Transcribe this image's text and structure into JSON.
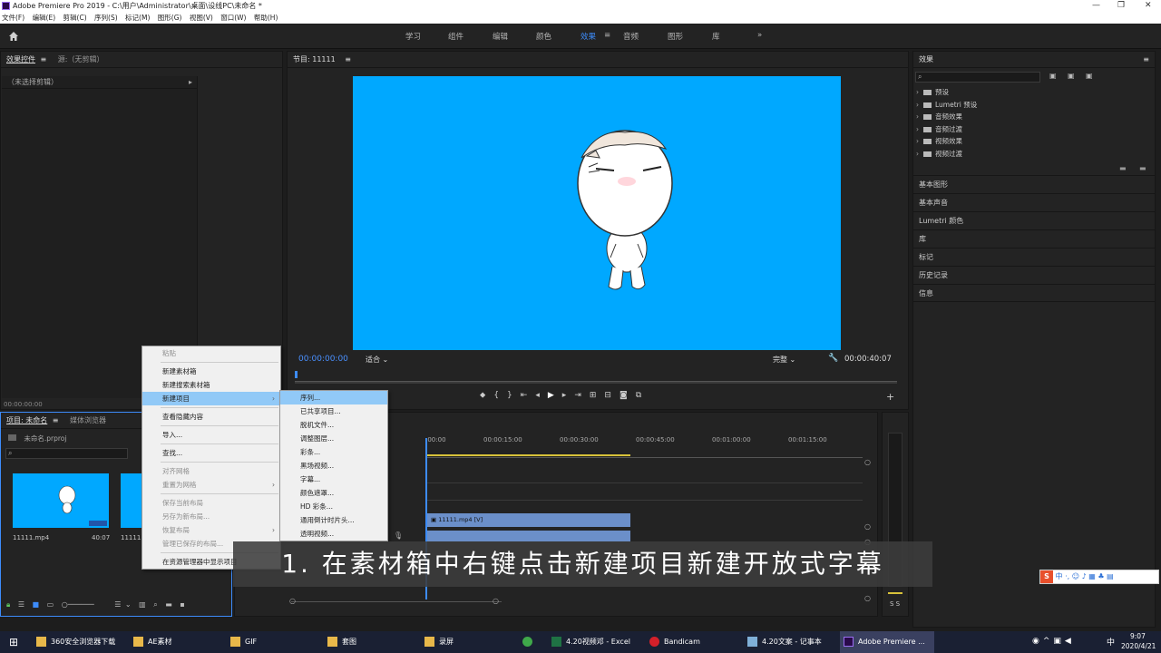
{
  "window": {
    "title": "Adobe Premiere Pro 2019 - C:\\用户\\Administrator\\桌面\\设线PC\\未命名 *"
  },
  "menubar": [
    "文件(F)",
    "编辑(E)",
    "剪辑(C)",
    "序列(S)",
    "标记(M)",
    "图形(G)",
    "视图(V)",
    "窗口(W)",
    "帮助(H)"
  ],
  "workspace": {
    "tabs": [
      "学习",
      "组件",
      "编辑",
      "颜色",
      "效果",
      "音频",
      "图形",
      "库"
    ],
    "active": "效果",
    "more": "»"
  },
  "effect_controls": {
    "tab1": "效果控件",
    "tab2": "源:（无剪辑）",
    "no_clip": "（未选择剪辑）",
    "timecode": "00:00:00:00"
  },
  "program": {
    "title": "节目: 11111",
    "timecode_left": "00:00:00:00",
    "fit": "适合",
    "quality": "完整",
    "timecode_right": "00:00:40:07",
    "bg_color": "#00a8ff"
  },
  "project": {
    "tab1": "项目: 未命名",
    "tab2": "媒体浏览器",
    "file": "未命名.prproj",
    "items": [
      {
        "name": "11111.mp4",
        "duration": "40:07"
      },
      {
        "name": "11111"
      }
    ]
  },
  "context_menu": {
    "items": [
      {
        "label": "粘贴",
        "disabled": true
      },
      {
        "label": "新建素材箱"
      },
      {
        "label": "新建搜索素材箱"
      },
      {
        "label": "新建项目",
        "highlight": true,
        "submenu": true
      },
      {
        "sep": true
      },
      {
        "label": "查看隐藏内容"
      },
      {
        "sep": true
      },
      {
        "label": "导入..."
      },
      {
        "sep": true
      },
      {
        "label": "查找..."
      },
      {
        "sep": true
      },
      {
        "label": "对齐网格",
        "disabled": true
      },
      {
        "label": "重置为网格",
        "disabled": true,
        "submenu": true
      },
      {
        "sep": true
      },
      {
        "label": "保存当前布局",
        "disabled": true
      },
      {
        "label": "另存为新布局...",
        "disabled": true
      },
      {
        "label": "恢复布局",
        "disabled": true,
        "submenu": true
      },
      {
        "label": "管理已保存的布局...",
        "disabled": true
      },
      {
        "sep": true
      },
      {
        "label": "在资源管理器中显示项目"
      }
    ]
  },
  "submenu": {
    "items": [
      {
        "label": "序列...",
        "highlight": true
      },
      {
        "label": "已共享项目..."
      },
      {
        "label": "脱机文件..."
      },
      {
        "label": "调整图层..."
      },
      {
        "label": "彩条..."
      },
      {
        "label": "黑场视频..."
      },
      {
        "label": "字幕..."
      },
      {
        "label": "颜色遮罩..."
      },
      {
        "label": "HD 彩条..."
      },
      {
        "label": "通用倒计时片头..."
      },
      {
        "label": "透明视频..."
      }
    ]
  },
  "timeline": {
    "ruler": [
      ":00:00",
      "00:00:15:00",
      "00:00:30:00",
      "00:00:45:00",
      "00:01:00:00",
      "00:01:15:00"
    ],
    "clip": "11111.mp4 [V]"
  },
  "effects_panel": {
    "title": "效果",
    "tree": [
      "预设",
      "Lumetri 预设",
      "音频效果",
      "音频过渡",
      "视频效果",
      "视频过渡"
    ],
    "sections": [
      "基本图形",
      "基本声音",
      "Lumetri 颜色",
      "库",
      "标记",
      "历史记录",
      "信息"
    ]
  },
  "caption": "1. 在素材箱中右键点击新建项目新建开放式字幕",
  "audio_meter": {
    "label": "S S"
  },
  "taskbar": {
    "items": [
      "360安全浏览器下载",
      "AE素材",
      "GIF",
      "套图",
      "录屏",
      "",
      "4.20视频邓 - Excel",
      "Bandicam",
      "4.20文案 - 记事本",
      "Adobe Premiere ..."
    ],
    "ime": "中",
    "time": "9:07",
    "date": "2020/4/21"
  },
  "sogou": {
    "label": "中"
  }
}
